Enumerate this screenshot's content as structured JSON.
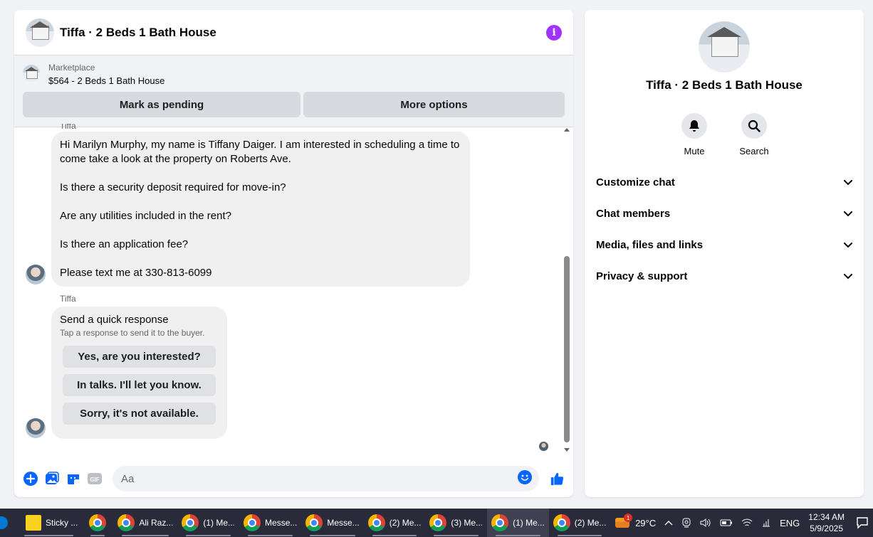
{
  "chat": {
    "title": "Tiffa · 2 Beds 1 Bath House",
    "marketplace": {
      "label": "Marketplace",
      "listing": "$564 - 2 Beds 1 Bath House",
      "mark_pending": "Mark as pending",
      "more_options": "More options"
    },
    "sender_name_top": "Tiffa",
    "message_lines": [
      "Hi Marilyn Murphy, my name is Tiffany Daiger. I am interested in scheduling a time to come take a look at the property on Roberts Ave.",
      "",
      "Is there a security deposit required for move-in?",
      "",
      "Are any utilities included in the rent?",
      "",
      "Is there an application fee?",
      "",
      "Please text me at 330-813-6099"
    ],
    "sender_name": "Tiffa",
    "quick_response": {
      "title": "Send a quick response",
      "subtitle": "Tap a response to send it to the buyer.",
      "options": [
        "Yes, are you interested?",
        "In talks. I'll let you know.",
        "Sorry, it's not available."
      ]
    },
    "composer": {
      "placeholder": "Aa"
    },
    "colors": {
      "accent": "#0866ff",
      "info": "#a033ff"
    }
  },
  "info_panel": {
    "name": "Tiffa · 2 Beds 1 Bath House",
    "actions": [
      {
        "label": "Mute",
        "icon": "bell-icon"
      },
      {
        "label": "Search",
        "icon": "search-icon"
      }
    ],
    "sections": [
      "Customize chat",
      "Chat members",
      "Media, files and links",
      "Privacy & support"
    ]
  },
  "taskbar": {
    "apps": [
      {
        "label": "Sticky ...",
        "icon": "sticky-notes-icon"
      },
      {
        "label": "",
        "icon": "chrome-icon"
      },
      {
        "label": "Ali Raz...",
        "icon": "chrome-icon"
      },
      {
        "label": "(1) Me...",
        "icon": "chrome-icon"
      },
      {
        "label": "Messe...",
        "icon": "chrome-icon"
      },
      {
        "label": "Messe...",
        "icon": "chrome-icon"
      },
      {
        "label": "(2) Me...",
        "icon": "chrome-icon"
      },
      {
        "label": "(3) Me...",
        "icon": "chrome-icon"
      },
      {
        "label": "(1) Me...",
        "icon": "chrome-icon"
      },
      {
        "label": "(2) Me...",
        "icon": "chrome-icon"
      }
    ],
    "weather": "29°C",
    "weather_badge": "1",
    "language": "ENG",
    "time": "12:34 AM",
    "date": "5/9/2025"
  }
}
